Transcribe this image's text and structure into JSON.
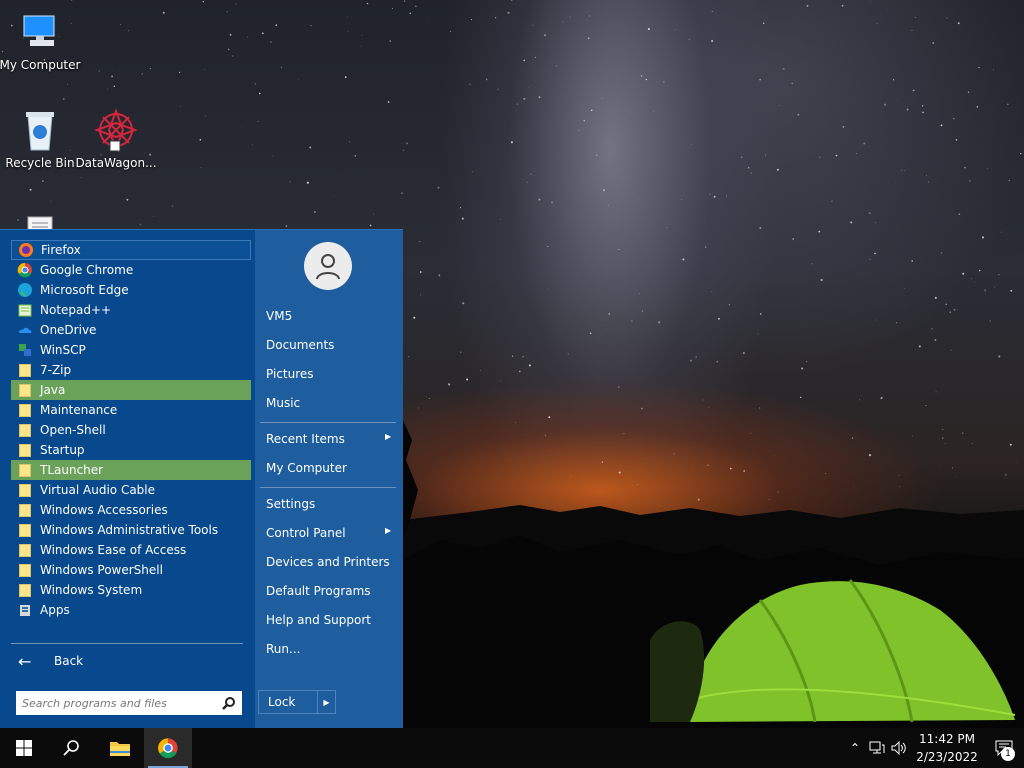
{
  "desktop": {
    "icons": [
      {
        "label": "My Computer",
        "icon": "computer-icon"
      },
      {
        "label": "Recycle Bin",
        "icon": "recycle-bin-icon"
      },
      {
        "label": "DataWagon...",
        "icon": "datawagon-icon"
      },
      {
        "label": "",
        "icon": "document-icon"
      }
    ]
  },
  "start_menu": {
    "programs": [
      {
        "label": "Firefox",
        "icon": "firefox-icon",
        "state": "selected"
      },
      {
        "label": "Google Chrome",
        "icon": "chrome-icon"
      },
      {
        "label": "Microsoft Edge",
        "icon": "edge-icon"
      },
      {
        "label": "Notepad++",
        "icon": "notepad-plus-plus-icon"
      },
      {
        "label": "OneDrive",
        "icon": "onedrive-icon"
      },
      {
        "label": "WinSCP",
        "icon": "winscp-icon"
      },
      {
        "label": "7-Zip",
        "icon": "folder-icon"
      },
      {
        "label": "Java",
        "icon": "folder-icon",
        "state": "highlighted"
      },
      {
        "label": "Maintenance",
        "icon": "folder-icon"
      },
      {
        "label": "Open-Shell",
        "icon": "folder-icon"
      },
      {
        "label": "Startup",
        "icon": "folder-icon"
      },
      {
        "label": "TLauncher",
        "icon": "folder-icon",
        "state": "highlighted"
      },
      {
        "label": "Virtual Audio Cable",
        "icon": "folder-icon"
      },
      {
        "label": "Windows Accessories",
        "icon": "folder-icon"
      },
      {
        "label": "Windows Administrative Tools",
        "icon": "folder-icon"
      },
      {
        "label": "Windows Ease of Access",
        "icon": "folder-icon"
      },
      {
        "label": "Windows PowerShell",
        "icon": "folder-icon"
      },
      {
        "label": "Windows System",
        "icon": "folder-icon"
      },
      {
        "label": "Apps",
        "icon": "apps-icon"
      }
    ],
    "back_label": "Back",
    "search_placeholder": "Search programs and files",
    "right_items": [
      {
        "label": "VM5"
      },
      {
        "label": "Documents"
      },
      {
        "label": "Pictures"
      },
      {
        "label": "Music"
      },
      {
        "label": "Recent Items",
        "submenu": true
      },
      {
        "label": "My Computer"
      },
      {
        "label": "Settings"
      },
      {
        "label": "Control Panel",
        "submenu": true
      },
      {
        "label": "Devices and Printers"
      },
      {
        "label": "Default Programs"
      },
      {
        "label": "Help and Support"
      },
      {
        "label": "Run..."
      }
    ],
    "lock_label": "Lock"
  },
  "taskbar": {
    "buttons": [
      "windows-start-icon",
      "search-icon",
      "file-explorer-icon",
      "chrome-icon"
    ],
    "tray_icons": [
      "chevron-up-icon",
      "network-icon",
      "volume-icon"
    ],
    "time": "11:42 PM",
    "date": "2/23/2022",
    "notification_count": "1"
  },
  "colors": {
    "menu_left": "#07498c",
    "menu_right": "#1e5e9f",
    "highlight": "#6aa25a",
    "folder": "#fde68a"
  }
}
